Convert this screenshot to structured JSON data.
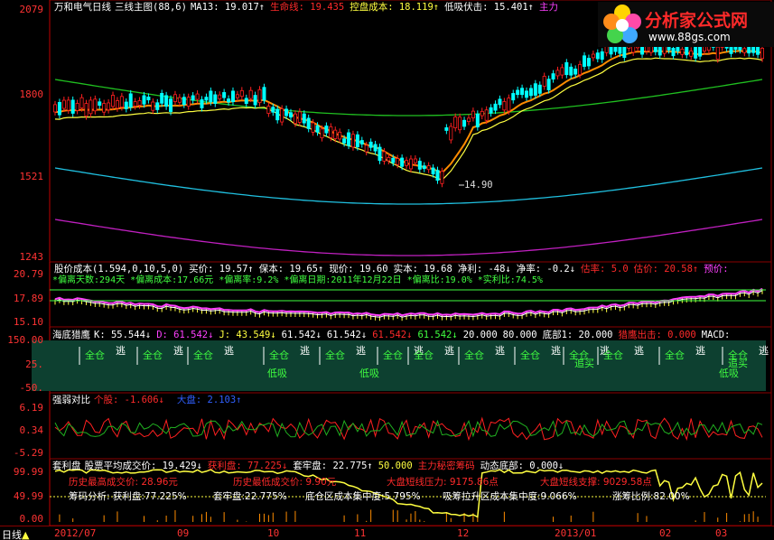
{
  "main_panel": {
    "title": "万和电气",
    "period": "日线",
    "indicator": "三线主图",
    "params": "(88,6)",
    "ma13": "MA13: 19.017↑",
    "life_line": "生命线: 19.435",
    "control_cost": "控盘成本: 18.119↑",
    "low_buy": "低吸伏击: 15.401↑",
    "main_force": "主力",
    "low_marker": "14.90",
    "y_labels": [
      "2079",
      "1800",
      "1521",
      "1243"
    ]
  },
  "cost_panel": {
    "title": "股价成本",
    "params": "(1.594,0,10,5,0)",
    "buy": "买价: 19.57↑",
    "hold": "保本: 19.65↑",
    "now": "现价: 19.60",
    "real": "实本: 19.68",
    "net_profit": "净利: -48↓",
    "net_pct": "净率: -0.2↓",
    "estimate_rate": "估率: 5.0",
    "estimate_price": "估价: 20.58↑",
    "predict": "预价:",
    "line2": [
      "*偏离天数:294天",
      "*偏离成本:17.66元",
      "*偏离率:9.2%",
      "*偏离日期:2011年12月22日",
      "*偏离比:19.0%",
      "*实利比:74.5%"
    ],
    "y_labels": [
      "20.79",
      "17.89",
      "15.10"
    ]
  },
  "eagle_panel": {
    "title": "海底猎鹰",
    "k": "K: 55.544↓",
    "d": "D: 61.542↓",
    "j": "J: 43.549↓",
    "v1": "61.542↓",
    "v2": "61.542↓",
    "v3": "61.542↓",
    "v4": "61.542↓",
    "v5": "20.000",
    "v6": "80.000",
    "bottom1": "底部1: 20.000",
    "exit": "猎鹰出击: 0.000",
    "macd": "MACD:",
    "signal_buy": "全仓",
    "signal_escape": "逃",
    "signal_low": "低吸",
    "signal_chase": "追买",
    "y_labels": [
      "150.00",
      "25.",
      "-50."
    ]
  },
  "strength_panel": {
    "title": "强弱对比",
    "stock": "个股: -1.606↓",
    "market": "大盘: 2.103↑",
    "y_labels": [
      "6.19",
      "0.34",
      "-5.29"
    ]
  },
  "arb_panel": {
    "title": "套利盘",
    "avg_cost": "股票平均成交价: 19.429↓",
    "profit": "获利盘: 77.225↓",
    "locked": "套牢盘: 22.775↑",
    "fifty": "50.000",
    "main_chip": "主力秘密筹码",
    "dyn_bottom": "动态底部: 0.000↓",
    "hist_high": "历史最高成交价: 28.96元",
    "hist_low": "历史最低成交价: 9.90元",
    "market_press": "大盘短线压力: 9175.86点",
    "market_support": "大盘短线支撑: 9029.58点",
    "chip_analysis": "筹码分析: 获利盘:77.225%",
    "chip_locked": "套牢盘:22.775%",
    "chip_concentration": "底仓区成本集中度:5.795%",
    "chip_upper": "吸筹拉升区成本集中度:9.066%",
    "chip_ratio": "涨筹比例:82.00%",
    "y_labels": [
      "99.99",
      "49.99",
      "0.00"
    ]
  },
  "bottom_bar": {
    "period_tag": "日线",
    "dates": [
      "2012/07",
      "09",
      "10",
      "11",
      "12",
      "2013/01",
      "02",
      "03"
    ]
  },
  "logo": {
    "name": "分析家公式网",
    "url": "www.88gs.com"
  },
  "colors": {
    "red": "#ff2a2a",
    "candle_up": "#ff2020",
    "candle_down": "#00ffff",
    "green_line": "#20c020",
    "orange_line": "#ff8c00",
    "yellow_line": "#ffff40",
    "cyan_line": "#20c0e0",
    "magenta_line": "#c020c0",
    "eagle_bg": "#0d4030"
  }
}
